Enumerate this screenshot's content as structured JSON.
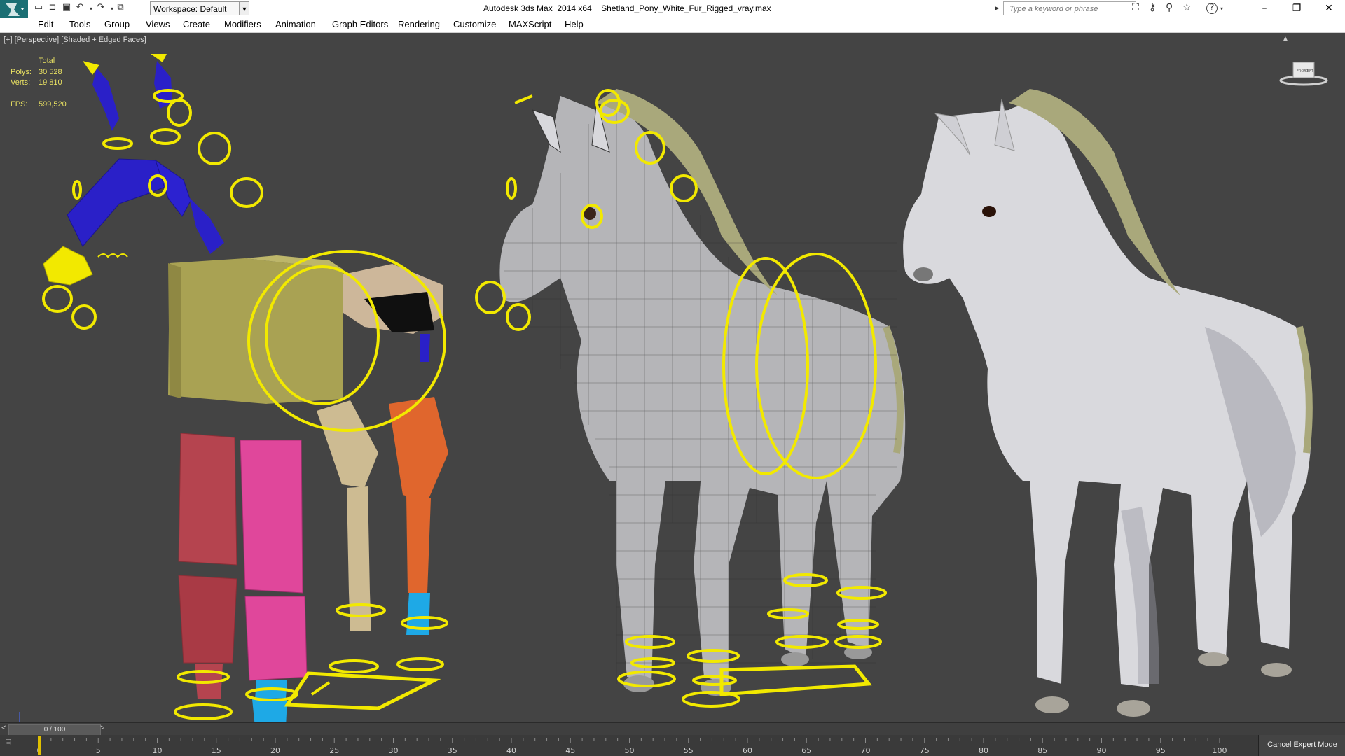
{
  "titlebar": {
    "app_title": "Autodesk 3ds Max  2014 x64    Shetland_Pony_White_Fur_Rigged_vray.max",
    "workspace": "Workspace: Default",
    "search_placeholder": "Type a keyword or phrase",
    "icons": [
      "new-file-icon",
      "open-file-icon",
      "save-icon",
      "undo-icon",
      "redo-icon",
      "project-icon"
    ],
    "window_buttons": [
      "minimize",
      "restore",
      "close"
    ]
  },
  "menu": {
    "items": [
      "Edit",
      "Tools",
      "Group",
      "Views",
      "Create",
      "Modifiers",
      "Animation",
      "Graph Editors",
      "Rendering",
      "Customize",
      "MAXScript",
      "Help"
    ]
  },
  "viewport": {
    "label": "[+] [Perspective] [Shaded + Edged Faces]",
    "stats": {
      "total_label": "Total",
      "polys_label": "Polys:",
      "polys_value": "30 528",
      "verts_label": "Verts:",
      "verts_value": "19 810",
      "fps_label": "FPS:",
      "fps_value": "599,520"
    },
    "viewcube_faces": [
      "FRONT",
      "LEFT"
    ],
    "colors": {
      "background": "#444444",
      "rig_yellow": "#f2e900",
      "spine_blue": "#2a20c8",
      "box_olive": "#a9a253",
      "leg_red": "#b5444f",
      "leg_pink": "#e0479b",
      "leg_tan": "#cdbb92",
      "leg_orange": "#e0662d",
      "hoof_cyan": "#1ea9e6",
      "fur_white": "#d9d9dd",
      "mane_olive": "#a9a87b"
    }
  },
  "timeline": {
    "frame_display": "0 / 100",
    "ticks": [
      0,
      5,
      10,
      15,
      20,
      25,
      30,
      35,
      40,
      45,
      50,
      55,
      60,
      65,
      70,
      75,
      80,
      85,
      90,
      95,
      100
    ],
    "cancel_expert": "Cancel Expert Mode"
  }
}
